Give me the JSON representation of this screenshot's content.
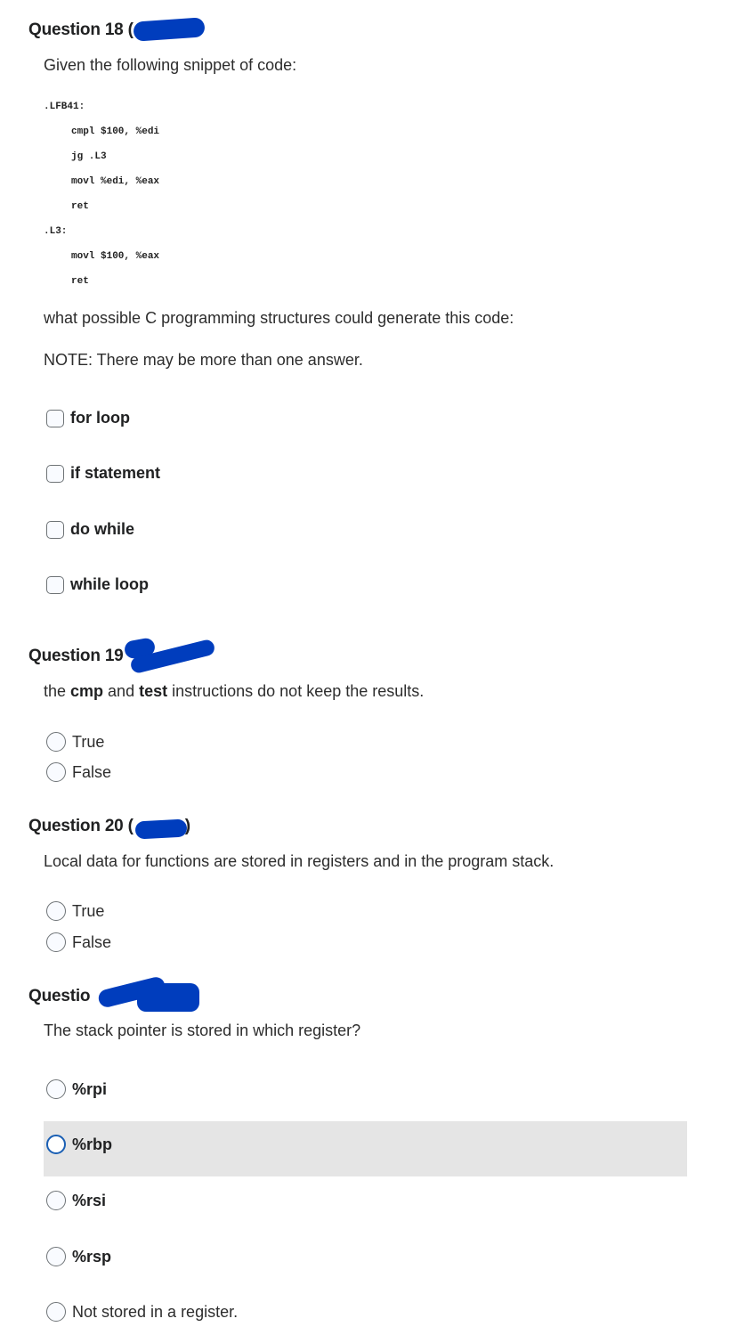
{
  "questions": [
    {
      "id": "q18",
      "title": "Question 18 (",
      "prompt": "Given the following snippet of code:",
      "code": {
        "label1": ".LFB41:",
        "lines1": [
          "cmpl $100, %edi",
          "jg .L3",
          "movl %edi, %eax",
          "ret"
        ],
        "label2": ".L3:",
        "lines2": [
          "movl $100, %eax",
          "ret"
        ]
      },
      "question": "what possible C programming structures could generate this code:",
      "note": "NOTE: There may be more than one answer.",
      "type": "checkbox",
      "options": [
        {
          "label": "for loop",
          "checked": false
        },
        {
          "label": "if statement",
          "checked": false
        },
        {
          "label": "do while",
          "checked": false
        },
        {
          "label": "while loop",
          "checked": false
        }
      ]
    },
    {
      "id": "q19",
      "title": "Question 19",
      "prompt_parts": [
        "the ",
        "cmp",
        " and ",
        "test",
        " instructions do not keep the results."
      ],
      "type": "radio",
      "options": [
        {
          "label": "True",
          "selected": false
        },
        {
          "label": "False",
          "selected": false
        }
      ]
    },
    {
      "id": "q20",
      "title": "Question 20 (",
      "title_suffix": ")",
      "prompt": "Local data for functions are stored in registers and in the program stack.",
      "type": "radio",
      "options": [
        {
          "label": "True",
          "selected": false
        },
        {
          "label": "False",
          "selected": false
        }
      ]
    },
    {
      "id": "q21",
      "title": "Questio",
      "prompt": "The stack pointer is stored in which register?",
      "type": "radio",
      "options": [
        {
          "label": "%rpi",
          "selected": false
        },
        {
          "label": "%rbp",
          "selected": false,
          "hovered": true
        },
        {
          "label": "%rsi",
          "selected": false
        },
        {
          "label": "%rsp",
          "selected": false
        },
        {
          "label": "Not stored in a register.",
          "selected": false
        }
      ]
    }
  ],
  "colors": {
    "redaction": "#003dbd",
    "hover_row": "#e5e5e5",
    "focus_ring": "#1a5fb4"
  }
}
